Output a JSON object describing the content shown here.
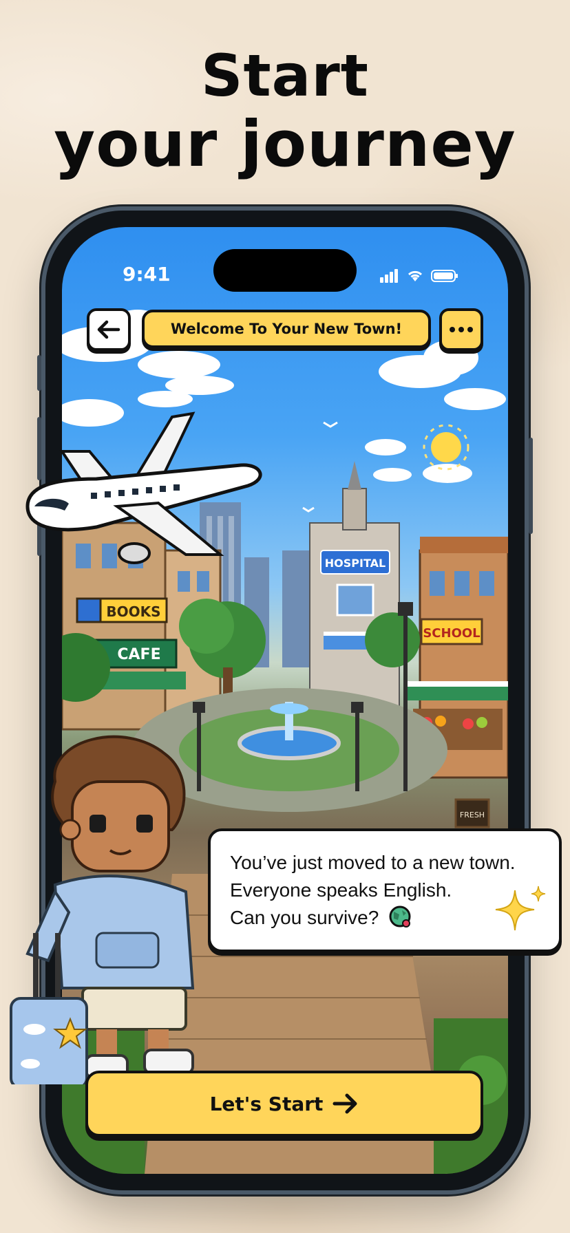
{
  "headline": {
    "line1": "Start",
    "line2": "your journey"
  },
  "status_bar": {
    "time": "9:41"
  },
  "topbar": {
    "title": "Welcome To Your New Town!"
  },
  "scene": {
    "signs": {
      "books": "BOOKS",
      "cafe": "CAFE",
      "hospital": "HOSPITAL",
      "school": "SCHOOL",
      "fresh": "FRESH"
    }
  },
  "dialog": {
    "lines": [
      "You’ve just moved to a new town.",
      "Everyone speaks English.",
      "Can you survive?"
    ]
  },
  "cta": {
    "label": "Let's Start"
  },
  "colors": {
    "accent": "#ffd55a",
    "outline": "#111111",
    "sky": "#2f8ff0"
  }
}
